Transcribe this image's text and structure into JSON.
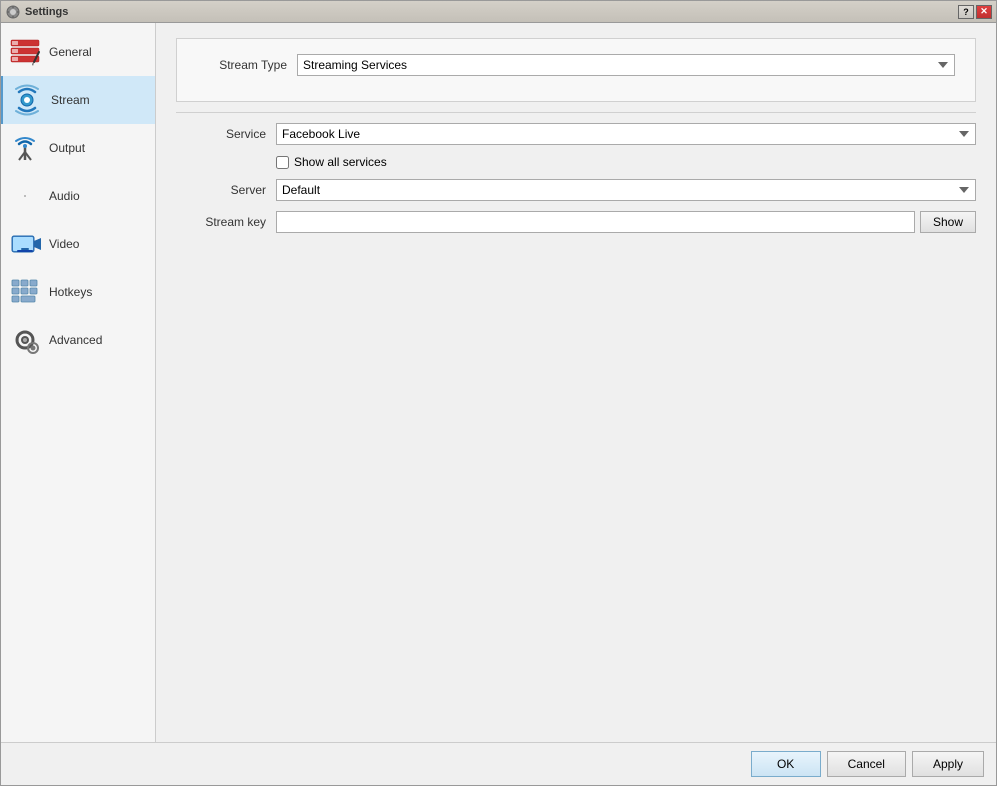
{
  "window": {
    "title": "Settings",
    "icon": "⚙"
  },
  "sidebar": {
    "items": [
      {
        "id": "general",
        "label": "General",
        "active": false
      },
      {
        "id": "stream",
        "label": "Stream",
        "active": true
      },
      {
        "id": "output",
        "label": "Output",
        "active": false
      },
      {
        "id": "audio",
        "label": "Audio",
        "active": false
      },
      {
        "id": "video",
        "label": "Video",
        "active": false
      },
      {
        "id": "hotkeys",
        "label": "Hotkeys",
        "active": false
      },
      {
        "id": "advanced",
        "label": "Advanced",
        "active": false
      }
    ]
  },
  "main": {
    "stream_type_label": "Stream Type",
    "stream_type_value": "Streaming Services",
    "service_label": "Service",
    "service_value": "Facebook Live",
    "show_all_services_label": "Show all services",
    "server_label": "Server",
    "server_value": "Default",
    "stream_key_label": "Stream key",
    "stream_key_value": "",
    "show_button_label": "Show"
  },
  "buttons": {
    "ok_label": "OK",
    "cancel_label": "Cancel",
    "apply_label": "Apply"
  }
}
